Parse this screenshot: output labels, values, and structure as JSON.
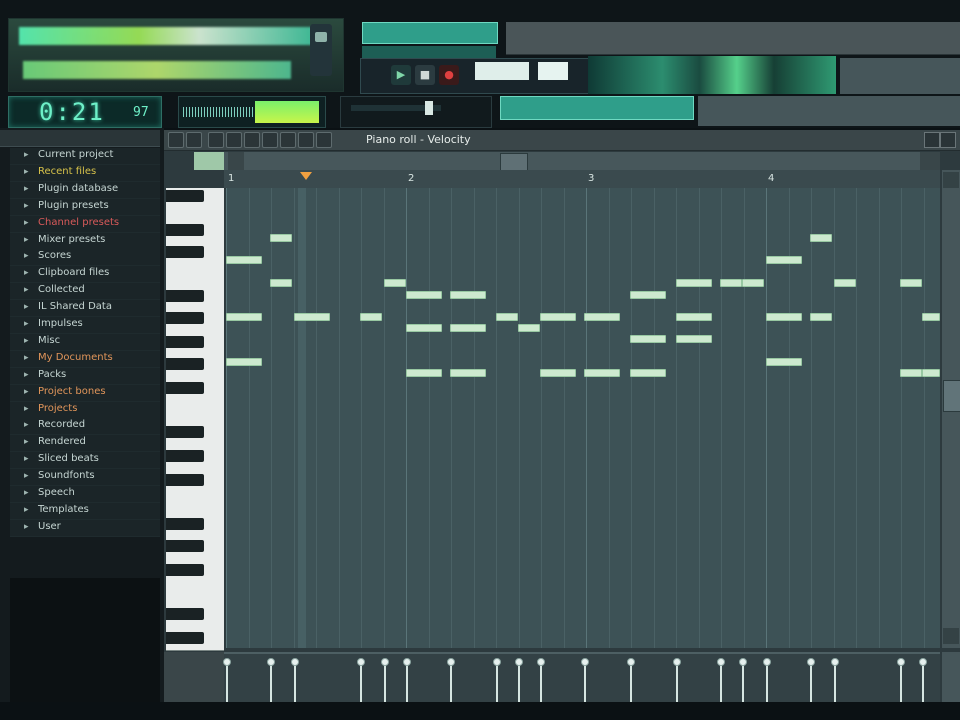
{
  "toolbar": {
    "hint": "",
    "time": "0:21",
    "time_sub": "97",
    "song_mode": ""
  },
  "browser": {
    "header": "",
    "items": [
      {
        "label": "Current project",
        "style": "normal"
      },
      {
        "label": "Recent files",
        "style": "hl"
      },
      {
        "label": "Plugin database",
        "style": "normal"
      },
      {
        "label": "Plugin presets",
        "style": "normal"
      },
      {
        "label": "Channel presets",
        "style": "red"
      },
      {
        "label": "Mixer presets",
        "style": "normal"
      },
      {
        "label": "Scores",
        "style": "normal"
      },
      {
        "label": "Clipboard files",
        "style": "normal"
      },
      {
        "label": "Collected",
        "style": "normal"
      },
      {
        "label": "IL Shared Data",
        "style": "normal"
      },
      {
        "label": "Impulses",
        "style": "normal"
      },
      {
        "label": "Misc",
        "style": "normal"
      },
      {
        "label": "My Documents",
        "style": "orange"
      },
      {
        "label": "Packs",
        "style": "normal"
      },
      {
        "label": "Project bones",
        "style": "orange"
      },
      {
        "label": "Projects",
        "style": "orange"
      },
      {
        "label": "Recorded",
        "style": "normal"
      },
      {
        "label": "Rendered",
        "style": "normal"
      },
      {
        "label": "Sliced beats",
        "style": "normal"
      },
      {
        "label": "Soundfonts",
        "style": "normal"
      },
      {
        "label": "Speech",
        "style": "normal"
      },
      {
        "label": "Templates",
        "style": "normal"
      },
      {
        "label": "User",
        "style": "normal"
      }
    ]
  },
  "piano_roll": {
    "title": "Piano roll - Velocity",
    "bar_numbers": [
      "1",
      "2",
      "3",
      "4"
    ]
  }
}
